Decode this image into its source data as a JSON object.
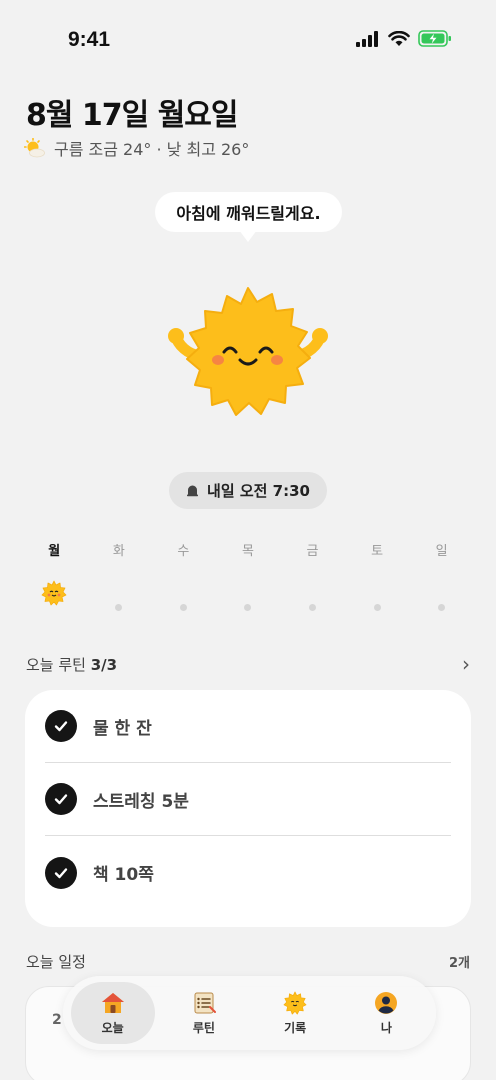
{
  "status_bar": {
    "time": "9:41"
  },
  "header": {
    "date": "8월 17일 월요일",
    "weather": "구름 조금 24° · 낮 최고 26°",
    "weather_icon": "partly-cloudy-icon"
  },
  "mascot": {
    "speech": "아침에 깨워드릴게요.",
    "icon": "sun-mascot"
  },
  "alarm": {
    "label": "내일 오전 7:30",
    "icon": "bell-icon"
  },
  "week": {
    "days": [
      {
        "label": "월",
        "active": true,
        "mark": "sun"
      },
      {
        "label": "화",
        "active": false,
        "mark": "dot"
      },
      {
        "label": "수",
        "active": false,
        "mark": "dot"
      },
      {
        "label": "목",
        "active": false,
        "mark": "dot"
      },
      {
        "label": "금",
        "active": false,
        "mark": "dot"
      },
      {
        "label": "토",
        "active": false,
        "mark": "dot"
      },
      {
        "label": "일",
        "active": false,
        "mark": "dot"
      }
    ]
  },
  "routine": {
    "title_prefix": "오늘 루틴",
    "progress": "3/3",
    "items": [
      {
        "label": "물 한 잔",
        "checked": true
      },
      {
        "label": "스트레칭 5분",
        "checked": true
      },
      {
        "label": "책 10쪽",
        "checked": true
      }
    ]
  },
  "schedule": {
    "title": "오늘 일정",
    "count": "2개",
    "peek": "2"
  },
  "tab_bar": {
    "tabs": [
      {
        "label": "오늘",
        "icon": "house-icon",
        "active": true
      },
      {
        "label": "루틴",
        "icon": "checklist-icon",
        "active": false
      },
      {
        "label": "기록",
        "icon": "sun-icon",
        "active": false
      },
      {
        "label": "나",
        "icon": "profile-icon",
        "active": false
      }
    ]
  },
  "colors": {
    "background": "#f2f2f2",
    "sun": "#FDBE1B",
    "check": "#151515",
    "battery": "#34C759"
  }
}
